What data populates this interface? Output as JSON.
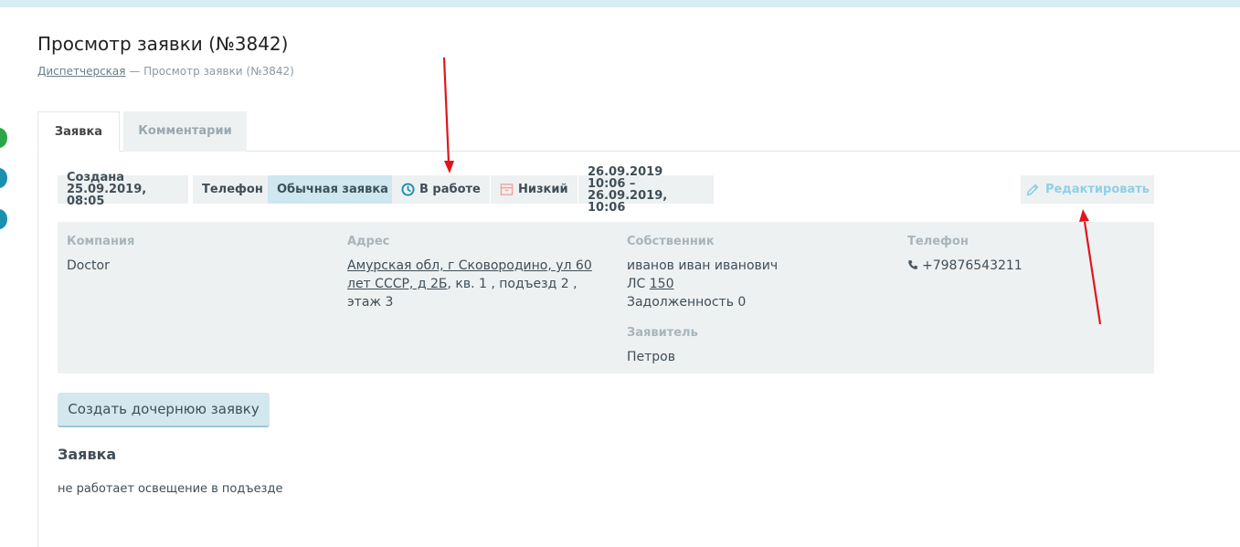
{
  "page": {
    "title": "Просмотр заявки (№3842)",
    "breadcrumb": {
      "root": "Диспетчерская",
      "separator": " — ",
      "current": "Просмотр заявки (№3842)"
    }
  },
  "tabs": [
    {
      "label": "Заявка",
      "active": true
    },
    {
      "label": "Комментарии",
      "active": false
    }
  ],
  "chips": {
    "created_label": "Создана",
    "created_value": "25.09.2019, 08:05",
    "source": "Телефон",
    "type": "Обычная заявка",
    "status": "В работе",
    "priority": "Низкий",
    "period_start": "26.09.2019 10:06 –",
    "period_end": "26.09.2019, 10:06"
  },
  "edit_button": {
    "label": "Редактировать"
  },
  "info": {
    "company_label": "Компания",
    "company": "Doctor",
    "address_label": "Адрес",
    "address_link": "Амурская обл, г Сковородино, ул 60 лет СССР, д 2Б",
    "address_rest": ", кв. 1 , подъезд 2 , этаж 3",
    "owner_label": "Собственник",
    "owner_name": "иванов иван иванович",
    "account_prefix": "ЛС ",
    "account_number": "150",
    "debt": "Задолженность 0",
    "applicant_label": "Заявитель",
    "applicant": "Петров",
    "phone_label": "Телефон",
    "phone": "+79876543211"
  },
  "create_child_button": {
    "label": "Создать дочернюю заявку"
  },
  "request": {
    "title": "Заявка",
    "text": "не работает освещение в подъезде"
  },
  "colors": {
    "accent": "#1b8fb0",
    "chip_bg": "#eef1f2",
    "chip_blue": "#cfe7ee",
    "annotation_arrow": "#e0161b"
  }
}
